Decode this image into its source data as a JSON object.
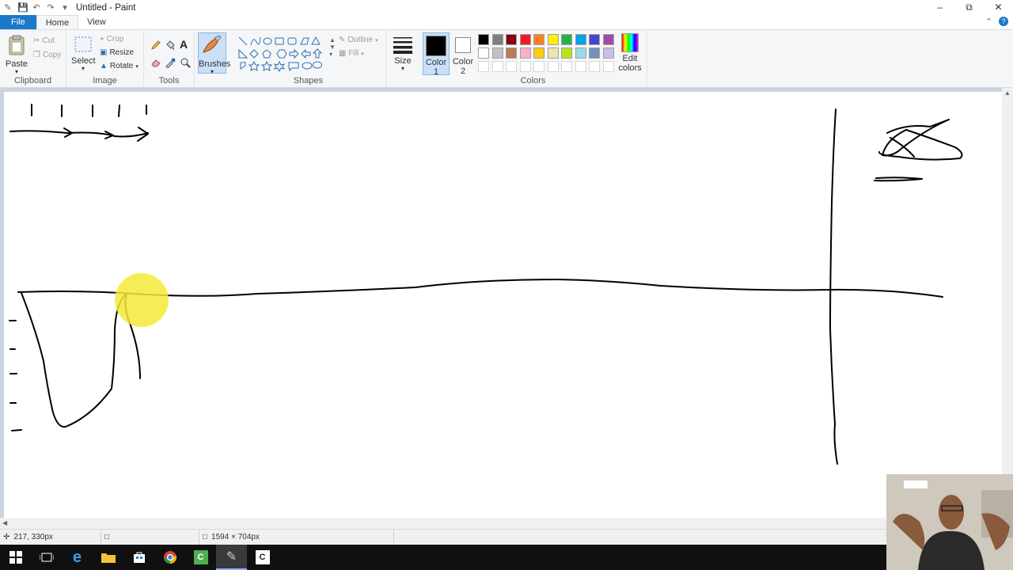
{
  "window": {
    "title": "Untitled - Paint"
  },
  "tabs": {
    "file": "File",
    "home": "Home",
    "view": "View"
  },
  "ribbon": {
    "clipboard": {
      "label": "Clipboard",
      "paste": "Paste",
      "cut": "Cut",
      "copy": "Copy"
    },
    "image": {
      "label": "Image",
      "select": "Select",
      "crop": "Crop",
      "resize": "Resize",
      "rotate": "Rotate"
    },
    "tools": {
      "label": "Tools"
    },
    "brushes": {
      "label": "Brushes"
    },
    "shapes": {
      "label": "Shapes",
      "outline": "Outline",
      "fill": "Fill"
    },
    "size": {
      "label": "Size"
    },
    "color1": {
      "label": "Color",
      "num": "1"
    },
    "color2": {
      "label": "Color",
      "num": "2"
    },
    "colors": {
      "label": "Colors"
    },
    "edit_colors": {
      "line1": "Edit",
      "line2": "colors"
    },
    "palette_row1": [
      "#000000",
      "#7f7f7f",
      "#880015",
      "#ed1c24",
      "#ff7f27",
      "#fff200",
      "#22b14c",
      "#00a2e8",
      "#3f48cc",
      "#a349a4"
    ],
    "palette_row2": [
      "#ffffff",
      "#c3c3c3",
      "#b97a57",
      "#ffaec9",
      "#ffc90e",
      "#efe4b0",
      "#b5e61d",
      "#99d9ea",
      "#7092be",
      "#c8bfe7"
    ],
    "active_color1": "#000000",
    "active_color2": "#ffffff"
  },
  "status": {
    "cursor_pos": "217, 330px",
    "canvas_size": "1594 × 704px"
  }
}
